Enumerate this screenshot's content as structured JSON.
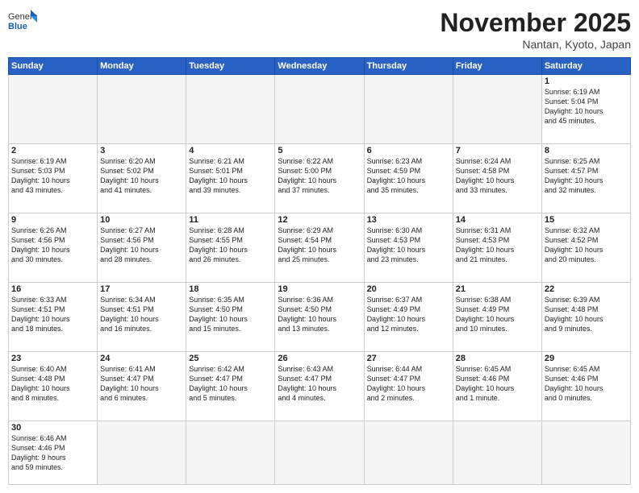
{
  "header": {
    "logo_general": "General",
    "logo_blue": "Blue",
    "month_title": "November 2025",
    "location": "Nantan, Kyoto, Japan"
  },
  "weekdays": [
    "Sunday",
    "Monday",
    "Tuesday",
    "Wednesday",
    "Thursday",
    "Friday",
    "Saturday"
  ],
  "days": [
    {
      "date": "",
      "info": ""
    },
    {
      "date": "",
      "info": ""
    },
    {
      "date": "",
      "info": ""
    },
    {
      "date": "",
      "info": ""
    },
    {
      "date": "",
      "info": ""
    },
    {
      "date": "",
      "info": ""
    },
    {
      "date": "1",
      "info": "Sunrise: 6:19 AM\nSunset: 5:04 PM\nDaylight: 10 hours\nand 45 minutes."
    },
    {
      "date": "2",
      "info": "Sunrise: 6:19 AM\nSunset: 5:03 PM\nDaylight: 10 hours\nand 43 minutes."
    },
    {
      "date": "3",
      "info": "Sunrise: 6:20 AM\nSunset: 5:02 PM\nDaylight: 10 hours\nand 41 minutes."
    },
    {
      "date": "4",
      "info": "Sunrise: 6:21 AM\nSunset: 5:01 PM\nDaylight: 10 hours\nand 39 minutes."
    },
    {
      "date": "5",
      "info": "Sunrise: 6:22 AM\nSunset: 5:00 PM\nDaylight: 10 hours\nand 37 minutes."
    },
    {
      "date": "6",
      "info": "Sunrise: 6:23 AM\nSunset: 4:59 PM\nDaylight: 10 hours\nand 35 minutes."
    },
    {
      "date": "7",
      "info": "Sunrise: 6:24 AM\nSunset: 4:58 PM\nDaylight: 10 hours\nand 33 minutes."
    },
    {
      "date": "8",
      "info": "Sunrise: 6:25 AM\nSunset: 4:57 PM\nDaylight: 10 hours\nand 32 minutes."
    },
    {
      "date": "9",
      "info": "Sunrise: 6:26 AM\nSunset: 4:56 PM\nDaylight: 10 hours\nand 30 minutes."
    },
    {
      "date": "10",
      "info": "Sunrise: 6:27 AM\nSunset: 4:56 PM\nDaylight: 10 hours\nand 28 minutes."
    },
    {
      "date": "11",
      "info": "Sunrise: 6:28 AM\nSunset: 4:55 PM\nDaylight: 10 hours\nand 26 minutes."
    },
    {
      "date": "12",
      "info": "Sunrise: 6:29 AM\nSunset: 4:54 PM\nDaylight: 10 hours\nand 25 minutes."
    },
    {
      "date": "13",
      "info": "Sunrise: 6:30 AM\nSunset: 4:53 PM\nDaylight: 10 hours\nand 23 minutes."
    },
    {
      "date": "14",
      "info": "Sunrise: 6:31 AM\nSunset: 4:53 PM\nDaylight: 10 hours\nand 21 minutes."
    },
    {
      "date": "15",
      "info": "Sunrise: 6:32 AM\nSunset: 4:52 PM\nDaylight: 10 hours\nand 20 minutes."
    },
    {
      "date": "16",
      "info": "Sunrise: 6:33 AM\nSunset: 4:51 PM\nDaylight: 10 hours\nand 18 minutes."
    },
    {
      "date": "17",
      "info": "Sunrise: 6:34 AM\nSunset: 4:51 PM\nDaylight: 10 hours\nand 16 minutes."
    },
    {
      "date": "18",
      "info": "Sunrise: 6:35 AM\nSunset: 4:50 PM\nDaylight: 10 hours\nand 15 minutes."
    },
    {
      "date": "19",
      "info": "Sunrise: 6:36 AM\nSunset: 4:50 PM\nDaylight: 10 hours\nand 13 minutes."
    },
    {
      "date": "20",
      "info": "Sunrise: 6:37 AM\nSunset: 4:49 PM\nDaylight: 10 hours\nand 12 minutes."
    },
    {
      "date": "21",
      "info": "Sunrise: 6:38 AM\nSunset: 4:49 PM\nDaylight: 10 hours\nand 10 minutes."
    },
    {
      "date": "22",
      "info": "Sunrise: 6:39 AM\nSunset: 4:48 PM\nDaylight: 10 hours\nand 9 minutes."
    },
    {
      "date": "23",
      "info": "Sunrise: 6:40 AM\nSunset: 4:48 PM\nDaylight: 10 hours\nand 8 minutes."
    },
    {
      "date": "24",
      "info": "Sunrise: 6:41 AM\nSunset: 4:47 PM\nDaylight: 10 hours\nand 6 minutes."
    },
    {
      "date": "25",
      "info": "Sunrise: 6:42 AM\nSunset: 4:47 PM\nDaylight: 10 hours\nand 5 minutes."
    },
    {
      "date": "26",
      "info": "Sunrise: 6:43 AM\nSunset: 4:47 PM\nDaylight: 10 hours\nand 4 minutes."
    },
    {
      "date": "27",
      "info": "Sunrise: 6:44 AM\nSunset: 4:47 PM\nDaylight: 10 hours\nand 2 minutes."
    },
    {
      "date": "28",
      "info": "Sunrise: 6:45 AM\nSunset: 4:46 PM\nDaylight: 10 hours\nand 1 minute."
    },
    {
      "date": "29",
      "info": "Sunrise: 6:45 AM\nSunset: 4:46 PM\nDaylight: 10 hours\nand 0 minutes."
    },
    {
      "date": "30",
      "info": "Sunrise: 6:46 AM\nSunset: 4:46 PM\nDaylight: 9 hours\nand 59 minutes."
    }
  ]
}
